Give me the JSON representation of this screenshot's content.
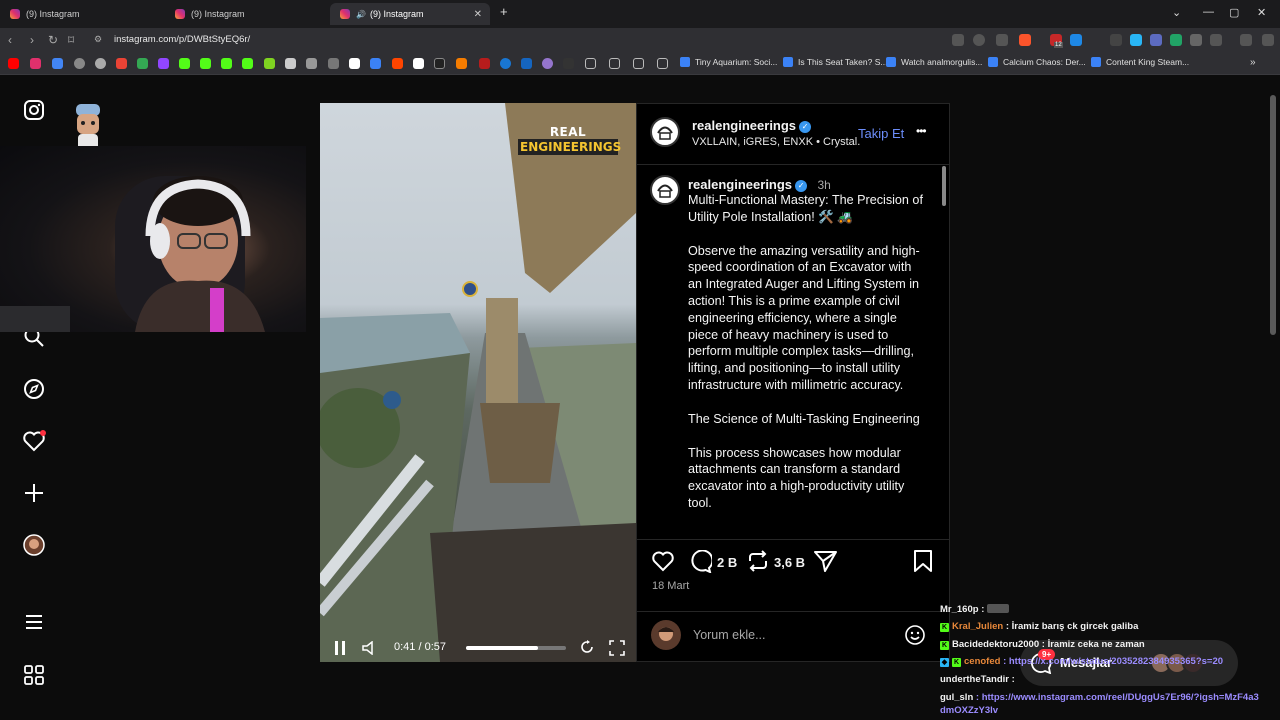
{
  "browser": {
    "tabs": [
      {
        "title": "(9) Instagram"
      },
      {
        "title": "(9) Instagram"
      },
      {
        "title": "(9) Instagram"
      }
    ],
    "url": "instagram.com/p/DWBtStyEQ6r/",
    "extension_badge": "12",
    "bookmarks": [
      {
        "label": "Tiny Aquarium: Soci..."
      },
      {
        "label": "Is This Seat Taken? S..."
      },
      {
        "label": "Watch analmorgulis..."
      },
      {
        "label": "Calcium Chaos: Der..."
      },
      {
        "label": "Content King Steam..."
      }
    ]
  },
  "post": {
    "header": {
      "username": "realengineerings",
      "subtitle": "VXLLAIN, iGRES, ENXK • Crystal...",
      "follow_label": "Takip Et",
      "more_label": "•••"
    },
    "caption": {
      "username": "realengineerings",
      "time_ago": "3h",
      "paragraphs": [
        "Multi-Functional Mastery: The Precision of Utility Pole Installation! 🛠️ 🚜",
        "Observe the amazing versatility and high-speed coordination of an Excavator with an Integrated Auger and Lifting System in action! This is a prime example of civil engineering efficiency, where a single piece of heavy machinery is used to perform multiple complex tasks—drilling, lifting, and positioning—to install utility infrastructure with millimetric accuracy.",
        "The Science of Multi-Tasking Engineering",
        "This process showcases how modular attachments can transform a standard excavator into a high-productivity utility tool."
      ]
    },
    "comment_count": "2 B",
    "repost_count": "3,6 B",
    "date": "18 Mart",
    "comment_placeholder": "Yorum ekle...",
    "video": {
      "badge_line1": "REAL",
      "badge_line2": "ENGINEERINGS",
      "time": "0:41 / 0:57",
      "progress": 0.72
    }
  },
  "messages": {
    "label": "Mesajlar",
    "badge": "9+"
  },
  "chat": [
    {
      "user": "Mr_160p",
      "text": ":"
    },
    {
      "user": "Kral_Julien",
      "text": ": İramiz barış ck gircek galiba"
    },
    {
      "user": "Bacidedektoru2000",
      "text": ": İramiz ceka ne zaman"
    },
    {
      "user": "cenofed",
      "text": ": https://x.com/w/status/2035282384935365?s=20"
    },
    {
      "user": "undertheTandir",
      "text": ":"
    },
    {
      "user": "gul_sln",
      "text": ": https://www.instagram.com/reel/DUggUs7Er96/?igsh=MzF4a3dmOXZzY3lv"
    }
  ],
  "colors": {
    "verified": "#3897f0",
    "follow": "#6c8dfa",
    "kick_green": "#53fc18",
    "link": "#9b8cff"
  }
}
